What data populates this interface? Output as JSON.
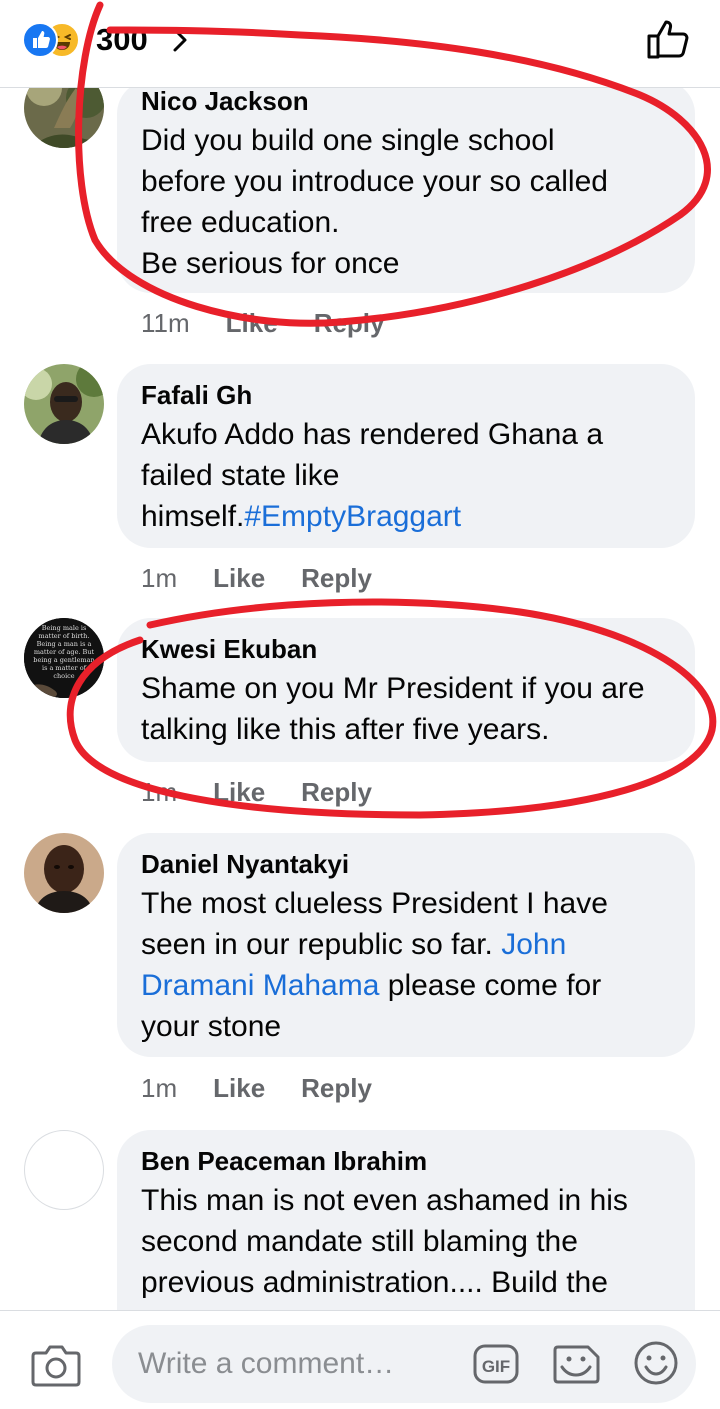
{
  "header": {
    "reaction_count": "300",
    "reactions": [
      "like-icon",
      "haha-icon"
    ]
  },
  "comments": [
    {
      "name": "Nico Jackson",
      "lines": [
        "Did you build one single school",
        "before you introduce your so called",
        "free education.",
        "Be serious for once"
      ],
      "time": "11m",
      "like": "Like",
      "reply": "Reply"
    },
    {
      "name": "Fafali Gh",
      "lines": [
        "Akufo Addo has rendered Ghana a",
        "failed state like"
      ],
      "line3_plain": "himself.",
      "line3_link": "#EmptyBraggart",
      "time": "1m",
      "like": "Like",
      "reply": "Reply"
    },
    {
      "name": "Kwesi Ekuban",
      "lines": [
        "Shame on you Mr President if you are",
        "talking like this after five years."
      ],
      "time": "1m",
      "like": "Like",
      "reply": "Reply"
    },
    {
      "name": "Daniel Nyantakyi",
      "line1": "The most clueless President I have",
      "line2_plain": "seen in our republic so far. ",
      "line2_link": "John",
      "line3_link": "Dramani Mahama",
      "line3_plain": " please come for",
      "line4": "your stone",
      "time": "1m",
      "like": "Like",
      "reply": "Reply"
    },
    {
      "name": "Ben Peaceman Ibrahim",
      "lines": [
        "This man is not even ashamed in his",
        "second mandate still blaming the",
        "previous administration.... Build the"
      ]
    }
  ],
  "avatar_quote": [
    "Being male is",
    "matter of birth.",
    "Being a man is a",
    "matter of age. But",
    "being a gentleman",
    "is a matter of",
    "choice"
  ],
  "composer": {
    "placeholder": "Write a comment…",
    "icons": [
      "camera-icon",
      "gif-icon",
      "sticker-icon",
      "emoji-icon"
    ]
  },
  "colors": {
    "like_blue": "#1877f2",
    "bubble_bg": "#f0f2f5",
    "link": "#1a6ed8",
    "annotation_red": "#e8202a"
  }
}
